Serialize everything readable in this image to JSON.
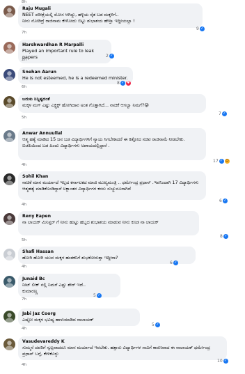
{
  "top_time": "8h",
  "comments": [
    {
      "name": "Raju Mugali",
      "text": "NEET ಪರೀಕ್ಷೆಯಲ್ಲಿ ಮೋಸ ಆಗಿದ್ದು, ಹಳ್ಳಿಯ ರೈತ ಬಡ ಮಕ್ಕಳಿಗೆ..\nನೀನು ನೋಡಿದ್ರೆ ರಾಜಿನಾಮ ಕೇಳೋದು ಬಿಟ್ಟು ಶುಭಾಶಯ ಹೇಳ್ತಾ ಇದ್ದೀಯಲ್ಲಾ !",
      "time": "7h",
      "reaction_count": "9",
      "reactions": [
        "like"
      ],
      "avatar_color": "#7a5a4a"
    },
    {
      "name": "Harshwardhan R Marpalli",
      "text": "Played an important rule to leak papers",
      "time": "2h",
      "reaction_count": "2",
      "reactions": [
        "like"
      ],
      "avatar_color": "#9a6a5a"
    },
    {
      "name": "Snehan Aarun",
      "text": "He is not esteemed, he is a redeemed minister.",
      "time": "6h",
      "reaction_count": "8",
      "reactions": [
        "like",
        "love"
      ],
      "avatar_color": "#3a4a7a"
    },
    {
      "name": "ಬದುಕು ನಿನ್ನಿಷ್ಟದಂತೆ",
      "text": "ಮಕ್ಕಳ ಮಗ್ ಎಷ್ಟು ಎಕ್ಸ್ಪಿಕ್ಸ್ ಹೋಗಿದಾವ ಅಂತ ಗೊತ್ತಾಗಿದೆ... ನಾಚಿಕೆ ಆಗಲ್ವಾ ನಿಮಗೆ?😜",
      "time": "5h",
      "reaction_count": "7",
      "reactions": [
        "like"
      ],
      "avatar_color": "#5a4a2a"
    },
    {
      "name": "Anwar Annuullal",
      "text": "ಆತ್ಮ ಹತ್ಯೆ ಮಾಡಿದ 15 ಜನ ಬಡ ವಿದ್ಯಾರ್ಥಿಗಳಿಗೆ ನ್ಯಾಯ ಸಿಗಬೇಕಾದರೆ ಈ ಕಿತ್ತೋದ ಸಚಿವ ರಾಜಿನಾಮೆ ನೀಡಬೇಕು.\nಬಿಜೆಪಿಯಿಂದ ಬಡ ಹಿಂದು ವಿದ್ಯಾರ್ಥಿಗಳು ಅಪಾಯದಲ್ಲಿದ್ದಾರೆ .",
      "time": "4h",
      "reaction_count": "17",
      "reactions": [
        "like",
        "haha"
      ],
      "avatar_color": "#6a7a8a"
    },
    {
      "name": "Sohil Khan",
      "text": "ನಾಚಿಕೆ ಮಾನ ಮರ್ಯಾದೆ ಇಲ್ಲದ ಕರ್ನಾಟಕದ ಮಾಜಿ ಮುಖ್ಯಮಂತ್ರಿ .. ಧರ್ಮೇಂದ್ರ ಪ್ರಧಾನ್ .ಇವನಿಂದಾಗಿ 17 ವಿದ್ಯಾರ್ಥಿಗಳು ಆತ್ಮಹತ್ಯೆ ಮಾಡಿಕೊಂಡಿದ್ದಾರೆ ಲಕ್ಷಾಂತರ ವಿದ್ಯಾರ್ಥಿಗಳ ಕನಸು ನುಚ್ಚುನೂರಾಗಿದೆ",
      "time": "4h",
      "reaction_count": "6",
      "reactions": [
        "like"
      ],
      "avatar_color": "#2a2a2a"
    },
    {
      "name": "Reny Eapen",
      "text": "ನಾ ಲಾಯಕ್ ಮಿನಿಸ್ಟರ್ ಗೆ ನೀನು ಹುಟ್ಟು ಹಬ್ಬದ ಶುಭಾಶಯ ಮಾಡುವ ನೀನು ಕೂಡ ನಾ ಲಾಯಕ್",
      "time": "5h",
      "reaction_count": "8",
      "reactions": [
        "like"
      ],
      "avatar_color": "#4a3a3a"
    },
    {
      "name": "Shafi Hassan",
      "text": "ಹೋಗಿ ಹೋಗಿ ಯುವ ಮಕ್ಕಳ ಹಂತಕನಿಗೆ ಶುಭಕೋರುತ್ತಾ ಇದ್ದೀರಾ?",
      "time": "4h",
      "reaction_count": "6",
      "reactions": [
        "like"
      ],
      "avatar_color": "#c9cdd3"
    },
    {
      "name": "Junaid Bc",
      "text": "ನೀಟ್ ಲೀಕ್ ನಲ್ಲಿ ನಿಮಗೆ ಎಷ್ಟು ಶೇರ್ ಇದೆ..\nಕುಮಾರಣ್ಣ",
      "time": "7h",
      "reaction_count": "5",
      "reactions": [
        "like"
      ],
      "avatar_color": "#3a5a6a"
    },
    {
      "name": "Jabi Jaz Coorg",
      "text": "ಎಷ್ಟೋ ಮಕ್ಕಳ ಭವಿಷ್ಯ ಹಾಳುಮಾಡಿದ ನಾಲಾಯಕ್",
      "time": "4h",
      "reaction_count": "5",
      "reactions": [
        "like"
      ],
      "avatar_color": "#3a4a2a"
    },
    {
      "name": "Vasudevareddy K",
      "text": "ಸುಮ್ಮನೆ ದವರಿಗೆ ಸ್ವಲ್ಪವಾದರೂ ಮಾನ ಮರ್ಯಾದೆ ಇರಬೇಕು. ಹತ್ತಾರು ವಿದ್ಯಾರ್ಥಿಗಳ ಸಾವಿಗೆ ಕಾರಣವಾದ ಈ ನಾಲಾಯಕ್ ಧರ್ಮೇಂದ್ರ ಪ್ರಧಾನ್ ಬಗ್ಗೆ, ಕೇಳಿಕೊಳ್ಳು",
      "time": "4h",
      "reaction_count": "10",
      "reactions": [
        "like"
      ],
      "avatar_color": "#6a5a3a"
    }
  ]
}
